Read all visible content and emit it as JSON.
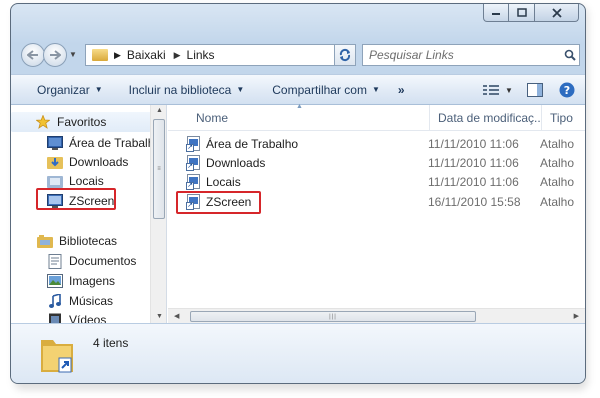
{
  "address": {
    "crumbs": [
      "Baixaki",
      "Links"
    ],
    "search_placeholder": "Pesquisar Links"
  },
  "toolbar": {
    "organize_label": "Organizar",
    "include_label": "Incluir na biblioteca",
    "share_label": "Compartilhar com",
    "more_label": "»"
  },
  "sidebar": {
    "favorites_label": "Favoritos",
    "favorites": [
      "Área de Trabalho",
      "Downloads",
      "Locais",
      "ZScreen"
    ],
    "libraries_label": "Bibliotecas",
    "libraries": [
      "Documentos",
      "Imagens",
      "Músicas",
      "Vídeos"
    ]
  },
  "columns": {
    "name": "Nome",
    "date": "Data de modificaç...",
    "type": "Tipo"
  },
  "files": [
    {
      "name": "Área de Trabalho",
      "date": "11/11/2010 11:06",
      "type": "Atalho"
    },
    {
      "name": "Downloads",
      "date": "11/11/2010 11:06",
      "type": "Atalho"
    },
    {
      "name": "Locais",
      "date": "11/11/2010 11:06",
      "type": "Atalho"
    },
    {
      "name": "ZScreen",
      "date": "16/11/2010 15:58",
      "type": "Atalho"
    }
  ],
  "details": {
    "item_count": "4 itens"
  },
  "colors": {
    "highlight": "#d6262a",
    "toolbar_text": "#1e395b"
  }
}
